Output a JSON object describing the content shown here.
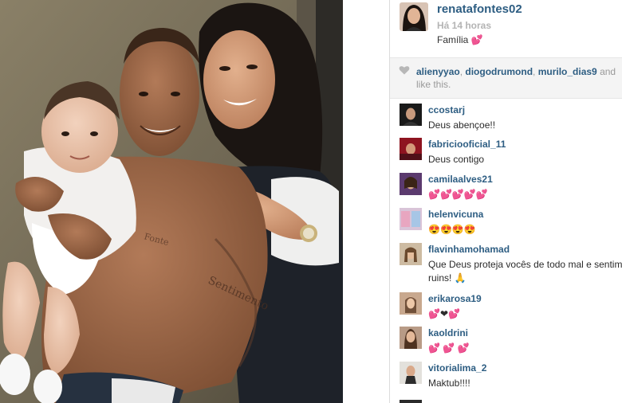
{
  "post": {
    "username": "renatafontes02",
    "timestamp": "Há 14 horas",
    "caption": "Família 💕"
  },
  "likes": {
    "likers": [
      "alienyyao",
      "diogodrumond",
      "murilo_dias9"
    ],
    "separator_1": ", ",
    "separator_2": ", ",
    "suffix_1": " and",
    "suffix_2": "like this."
  },
  "comments": [
    {
      "user": "ccostarj",
      "text": "Deus abençoe!!"
    },
    {
      "user": "fabriciooficial_11",
      "text": "Deus contigo"
    },
    {
      "user": "camilaalves21",
      "text": "💕💕💕💕💕"
    },
    {
      "user": "helenvicuna",
      "text": "😍😍😍😍"
    },
    {
      "user": "flavinhamohamad",
      "text": "Que Deus proteja vocês de todo mal e sentimentos ruins! 🙏"
    },
    {
      "user": "erikarosa19",
      "text": "💕❤💕"
    },
    {
      "user": "kaoldrini",
      "text": "💕 💕 💕"
    },
    {
      "user": "vitorialima_2",
      "text": "Maktub!!!!"
    }
  ],
  "icons": {
    "like": "heart-icon"
  },
  "colors": {
    "username": "#2d5d82",
    "muted": "#b4b4b4",
    "likes_bg": "#f4f4f4"
  }
}
